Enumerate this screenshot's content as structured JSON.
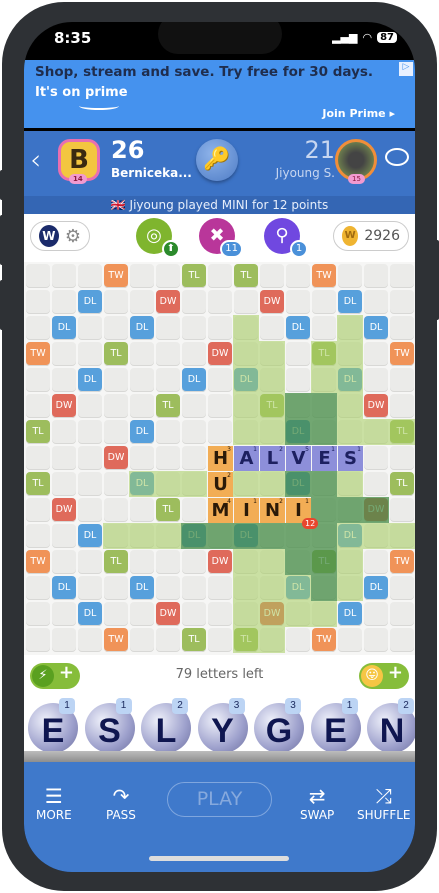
{
  "status": {
    "time": "8:35",
    "battery": "87"
  },
  "ad": {
    "headline": "Shop, stream and save. Try free for 30 days.",
    "brand": "It's on prime",
    "cta": "Join Prime ▸",
    "choice": "▷"
  },
  "header": {
    "back": "‹",
    "player1": {
      "initial": "B",
      "level": "14",
      "score": "26",
      "name": "Berniceka..."
    },
    "player2": {
      "level": "15",
      "score": "21",
      "name": "Jiyoung S."
    }
  },
  "announcement": "🇬🇧 Jiyoung played MINI for 12 points",
  "toolbar": {
    "logo": "W",
    "gear": "⚙",
    "powerups": [
      {
        "name": "radar",
        "icon": "◎",
        "badge": "⬆",
        "color": "#7fb52e"
      },
      {
        "name": "swap-plus",
        "icon": "✖",
        "badge": "11",
        "color": "#b9369a"
      },
      {
        "name": "hint-magnifier",
        "icon": "⚲",
        "badge": "1",
        "color": "#7048e0"
      }
    ],
    "coins": "2926",
    "coin_icon": "W"
  },
  "board": {
    "premiums": [
      "...T..t.t..T...",
      "..d..D...D..d..",
      ".d..d.....d..d.",
      "T..t...D...t..T",
      "..d...d.d...d..",
      ".D...t...t...D.",
      "t...d.....d...t",
      "...D...........",
      "t...d.....d...t",
      ".D...t.......D.",
      "..d...d.d...d..",
      "T..t...D...t..T",
      ".d..d.....d..d.",
      "..d..D...D..d..",
      "...T..t.t..T..."
    ],
    "highlights": [
      "...............",
      "...............",
      "........L...L..",
      "........LL.LL..",
      "........LL.LL..",
      "........LLDDL..",
      "........LLDDLLL",
      "...............",
      "....LLL.LLDDL..",
      "...........DDD.",
      "...LLLDDDDDDLLL",
      "........LLDDL..",
      "........LLLDL..",
      "........LLLL...",
      "........LL....."
    ],
    "tiles": [
      {
        "r": 7,
        "c": 7,
        "l": "H",
        "p": "3",
        "k": "o"
      },
      {
        "r": 7,
        "c": 8,
        "l": "A",
        "p": "1",
        "k": "p"
      },
      {
        "r": 7,
        "c": 9,
        "l": "L",
        "p": "2",
        "k": "p"
      },
      {
        "r": 7,
        "c": 10,
        "l": "V",
        "p": "5",
        "k": "p"
      },
      {
        "r": 7,
        "c": 11,
        "l": "E",
        "p": "1",
        "k": "p"
      },
      {
        "r": 7,
        "c": 12,
        "l": "S",
        "p": "1",
        "k": "p"
      },
      {
        "r": 8,
        "c": 7,
        "l": "U",
        "p": "2",
        "k": "o"
      },
      {
        "r": 9,
        "c": 7,
        "l": "M",
        "p": "4",
        "k": "o"
      },
      {
        "r": 9,
        "c": 8,
        "l": "I",
        "p": "1",
        "k": "o"
      },
      {
        "r": 9,
        "c": 9,
        "l": "N",
        "p": "2",
        "k": "o"
      },
      {
        "r": 9,
        "c": 10,
        "l": "I",
        "p": "1",
        "k": "o"
      }
    ],
    "last_move_score": "12",
    "labels": {
      "T": "TW",
      "D": "DW",
      "t": "TL",
      "d": "DL"
    }
  },
  "letters_left": "79 letters left",
  "boosts": {
    "left_icon": "⚡",
    "right_icon": "😛",
    "plus": "+"
  },
  "rack": [
    {
      "l": "E",
      "p": "1"
    },
    {
      "l": "S",
      "p": "1"
    },
    {
      "l": "L",
      "p": "2"
    },
    {
      "l": "Y",
      "p": "3"
    },
    {
      "l": "G",
      "p": "3"
    },
    {
      "l": "E",
      "p": "1"
    },
    {
      "l": "N",
      "p": "2"
    }
  ],
  "nav": {
    "more": "MORE",
    "pass": "PASS",
    "play": "PLAY",
    "swap": "SWAP",
    "shuffle": "SHUFFLE",
    "more_icon": "☰",
    "pass_icon": "↷",
    "swap_icon": "⇄",
    "shuffle_icon": "⤮"
  }
}
